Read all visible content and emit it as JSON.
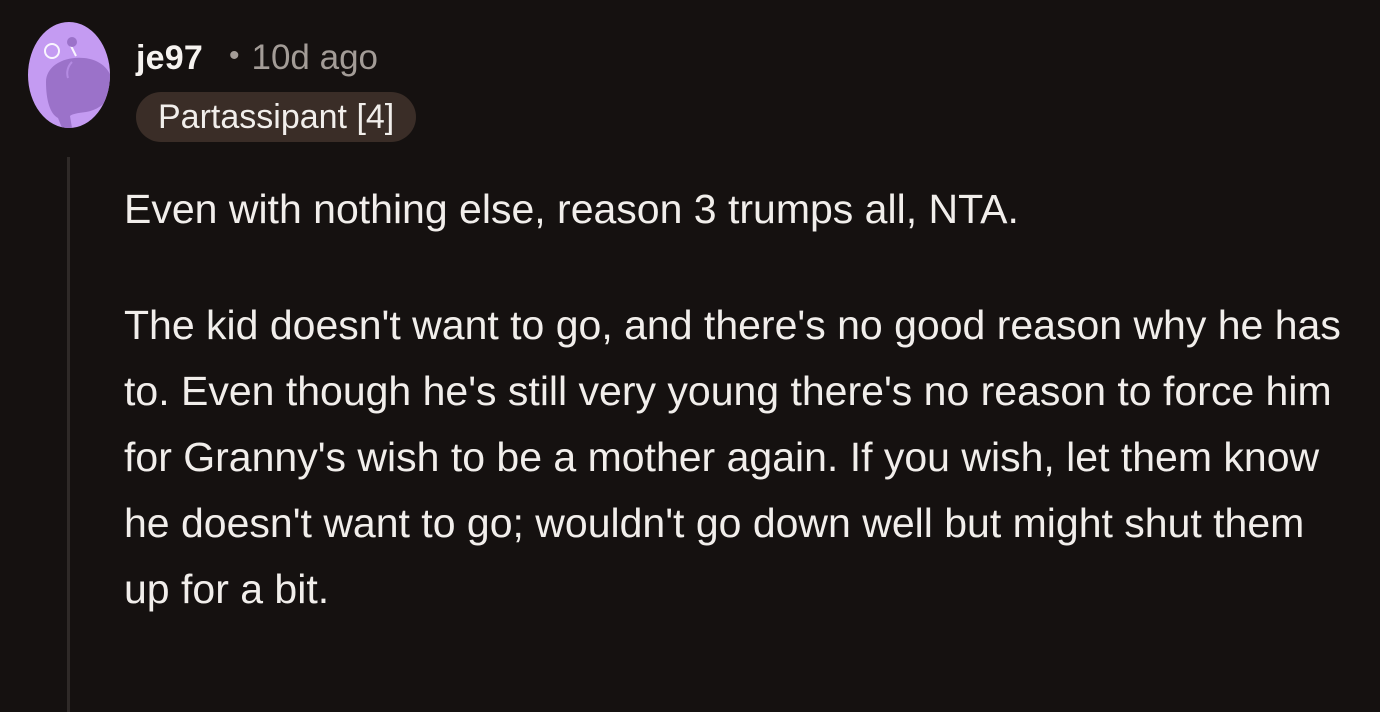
{
  "comment": {
    "author": "je97",
    "separator": "•",
    "timestamp": "10d ago",
    "flair": "Partassipant [4]",
    "paragraphs": [
      "Even with nothing else, reason 3 trumps all, NTA.",
      "The kid doesn't want to go, and there's no good reason why he has to. Even though he's still very young there's no reason to force him for Granny's wish to be a mother again. If you wish, let them know he doesn't want to go; wouldn't go down well but might shut them up for a bit."
    ]
  },
  "icons": {
    "avatar": "snoo-avatar-icon"
  },
  "colors": {
    "background": "#151110",
    "text": "#f1eeeb",
    "muted": "#a39c97",
    "avatar_bg": "#c49bf2",
    "avatar_fg": "#9b72c9",
    "flair_bg": "#3a2d27",
    "thread_line": "#2f2a28"
  }
}
